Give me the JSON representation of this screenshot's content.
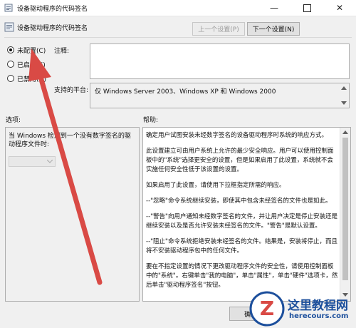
{
  "window": {
    "title": "设备驱动程序的代码签名"
  },
  "header": {
    "title": "设备驱动程序的代码签名"
  },
  "nav": {
    "prev_label": "上一个设置(P)",
    "next_label": "下一个设置(N)"
  },
  "radio": {
    "not_configured": "未配置(C)",
    "enabled": "已启用(E)",
    "disabled": "已禁用(D)",
    "selected": "not_configured"
  },
  "comment": {
    "label": "注释:"
  },
  "platform": {
    "label": "支持的平台:",
    "value": "仅 Windows Server 2003、Windows XP 和 Windows 2000"
  },
  "options": {
    "label": "选项:",
    "description": "当 Windows 检测到一个没有数字签名的驱动程序文件时:",
    "select_value": ""
  },
  "help": {
    "label": "帮助:",
    "paragraphs": [
      "确定用户试图安装未经数字签名的设备驱动程序时系统的响应方式。",
      "此设置建立可由用户系统上允许的最少安全响应。用户可以使用控制面板中的\"系统\"选择更安全的设置，但是如果启用了此设置，系统就不会实施任何安全性低于该设置的设置。",
      "如果启用了此设置，请使用下拉框指定所需的响应。",
      "--\"忽略\"命令系统继续安装，即使其中包含未经签名的文件也是如此。",
      "--\"警告\"向用户通知未经数字签名的文件，并让用户决定是停止安装还是继续安装以及是否允许安装未经签名的文件。\"警告\"是默认设置。",
      "--\"阻止\"命令系统拒绝安装未经签名的文件。结果是，安装将停止，而且将不安装驱动程序包中的任何文件。",
      "要在不指定设置的情况下更改驱动程序文件的安全性，请使用控制面板中的\"系统\"。右键单击\"我的电脑\"，单击\"属性\"，单击\"硬件\"选项卡，然后单击\"驱动程序签名\"按钮。"
    ]
  },
  "footer": {
    "ok_label": "确定"
  },
  "watermark": {
    "title": "这里教程网",
    "url": "herecours.com",
    "letter": "Z"
  },
  "colors": {
    "accent": "#d94a45",
    "watermark_blue": "#1c4f9c"
  }
}
